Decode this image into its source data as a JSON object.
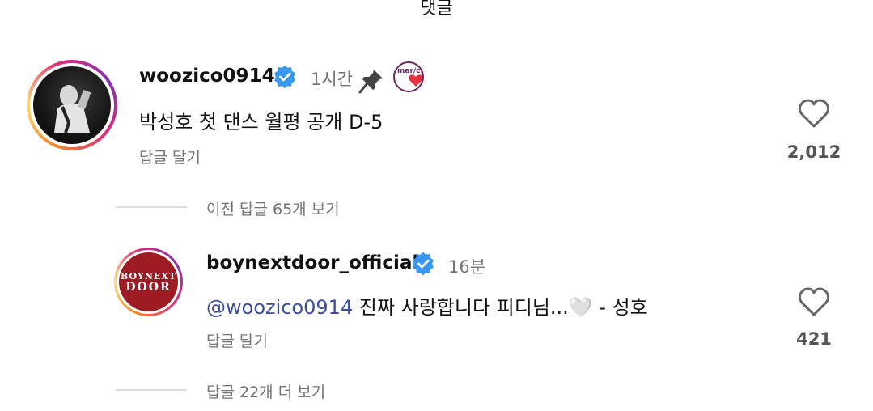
{
  "header": {
    "title": "댓글"
  },
  "comments": [
    {
      "username": "woozico0914",
      "time": "1시간",
      "text": "박성호 첫 댄스 월평 공개 D-5",
      "reply_label": "답글 달기",
      "likes": "2,012",
      "badge_text": "mar/cla/"
    },
    {
      "username": "boynextdoor_official",
      "time": "16분",
      "mention": "@woozico0914",
      "text": " 진짜 사랑합니다 피디님...🤍 - 성호",
      "reply_label": "답글 달기",
      "likes": "421",
      "avatar_logo_line1": "BOYNEXT",
      "avatar_logo_line2": "DOOR"
    }
  ],
  "threads": {
    "previous_replies": "이전 답글 65개 보기",
    "more_replies": "답글 22개 더 보기"
  },
  "colors": {
    "verified": "#3897f0",
    "mention": "#3b4e9d",
    "muted": "#737373"
  }
}
